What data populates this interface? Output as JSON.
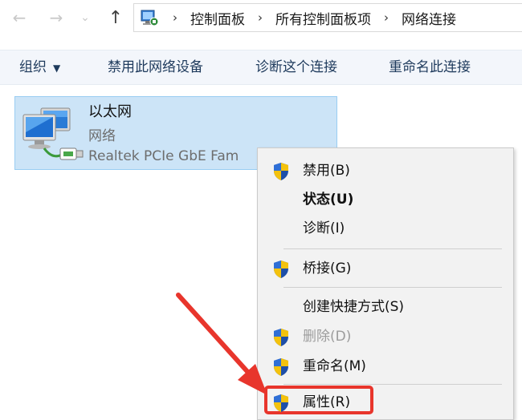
{
  "address_bar": {
    "back_icon": "arrow-left-icon",
    "forward_icon": "arrow-right-icon",
    "recent_icon": "chevron-down-icon",
    "up_icon": "arrow-up-icon",
    "breadcrumbs": [
      "控制面板",
      "所有控制面板项",
      "网络连接"
    ]
  },
  "toolbar": {
    "organize": "组织",
    "disable_device": "禁用此网络设备",
    "diagnose": "诊断这个连接",
    "rename": "重命名此连接"
  },
  "adapter": {
    "name": "以太网",
    "type": "网络",
    "description": "Realtek PCIe GbE Fam"
  },
  "context_menu": {
    "items": [
      {
        "label": "禁用(B)",
        "icon": "uac-shield-icon"
      },
      {
        "label": "状态(U)"
      },
      {
        "label": "诊断(I)"
      },
      {
        "label": "桥接(G)",
        "icon": "uac-shield-icon"
      },
      {
        "label": "创建快捷方式(S)"
      },
      {
        "label": "删除(D)",
        "icon": "uac-shield-icon"
      },
      {
        "label": "重命名(M)",
        "icon": "uac-shield-icon"
      },
      {
        "label": "属性(R)",
        "icon": "uac-shield-icon"
      }
    ]
  },
  "colors": {
    "selection": "#cce4f7",
    "annotation": "#e8352c",
    "menu_bg": "#f2f2f2"
  }
}
